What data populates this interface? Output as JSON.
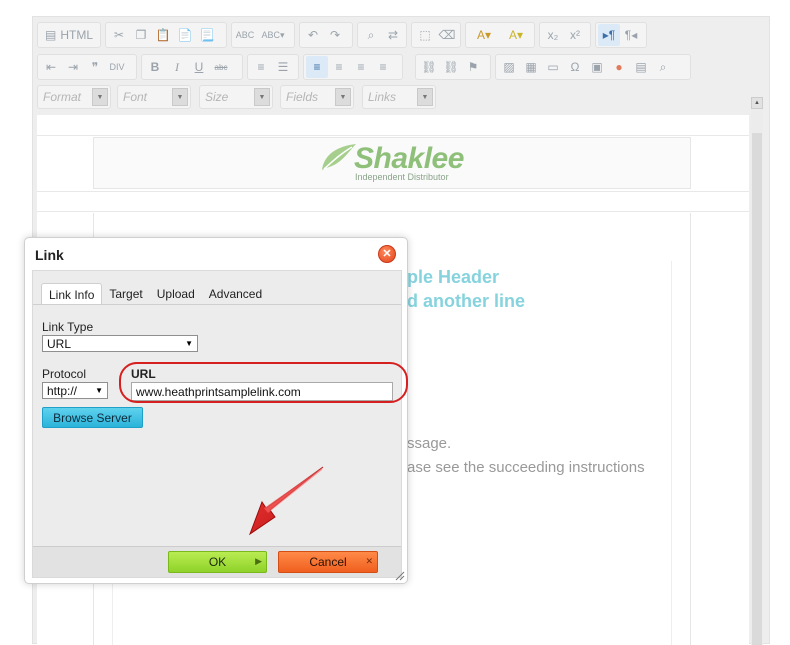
{
  "toolbar": {
    "html_label": "HTML",
    "combos": [
      "Format",
      "Font",
      "Size",
      "Fields",
      "Links"
    ]
  },
  "content": {
    "logo_word": "Shaklee",
    "logo_sub": "Independent Distributor",
    "header_line1": "ple Header",
    "header_line2": "d another line",
    "para_line1": "ssage.",
    "para_line2": "ase see the succeeding instructions"
  },
  "dialog": {
    "title": "Link",
    "tabs": [
      "Link Info",
      "Target",
      "Upload",
      "Advanced"
    ],
    "link_type_label": "Link Type",
    "link_type_value": "URL",
    "protocol_label": "Protocol",
    "protocol_value": "http://",
    "url_label": "URL",
    "url_value": "www.heathprintsamplelink.com",
    "browse_label": "Browse Server",
    "ok_label": "OK",
    "cancel_label": "Cancel"
  },
  "colors": {
    "accent_green": "#8fd22a",
    "accent_orange": "#f05f1f",
    "accent_cyan": "#2bb3d9",
    "annotation_red": "#e01e1e",
    "header_text": "#86d3de"
  }
}
